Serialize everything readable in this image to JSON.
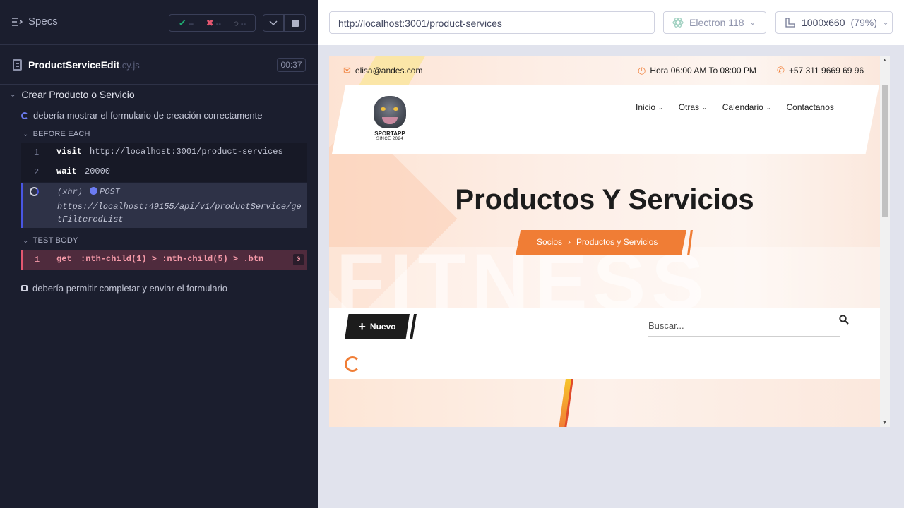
{
  "reporter": {
    "specs_label": "Specs",
    "stats": {
      "passed": "--",
      "failed": "--",
      "pending": "--"
    },
    "file": {
      "name": "ProductServiceEdit",
      "ext": ".cy.js",
      "duration": "00:37"
    },
    "suite_title": "Crear Producto o Servicio",
    "tests": [
      {
        "title": "debería mostrar el formulario de creación correctamente",
        "state": "running"
      },
      {
        "title": "debería permitir completar y enviar el formulario",
        "state": "pending"
      }
    ],
    "before_each_label": "BEFORE EACH",
    "before_each_commands": [
      {
        "num": "1",
        "name": "visit",
        "arg": "http://localhost:3001/product-services"
      },
      {
        "num": "2",
        "name": "wait",
        "arg": "20000"
      }
    ],
    "xhr": {
      "label": "(xhr)",
      "method": "POST",
      "url": "https://localhost:49155/api/v1/productService/getFilteredList"
    },
    "test_body_label": "TEST BODY",
    "test_body_commands": [
      {
        "num": "1",
        "name": "get",
        "arg": ":nth-child(1) > :nth-child(5) > .btn",
        "badge": "0"
      }
    ]
  },
  "browser": {
    "url": "http://localhost:3001/product-services",
    "browser_name": "Electron 118",
    "viewport": "1000x660",
    "zoom": "(79%)"
  },
  "site": {
    "email": "elisa@andes.com",
    "hours": "Hora 06:00 AM To 08:00 PM",
    "phone": "+57 311 9669 69 96",
    "logo_title": "SPORTAPP",
    "logo_subtitle": "SINCE 2024",
    "nav": [
      "Inicio",
      "Otras",
      "Calendario",
      "Contactanos"
    ],
    "hero_title": "Productos Y Servicios",
    "breadcrumb": [
      "Socios",
      "Productos y Servicios"
    ],
    "watermark": "FITNESS",
    "new_button": "Nuevo",
    "search_placeholder": "Buscar..."
  },
  "colors": {
    "accent": "#f07d35",
    "reporter_bg": "#1b1e2e",
    "running": "#6c7cf2",
    "failed": "#e45770"
  }
}
